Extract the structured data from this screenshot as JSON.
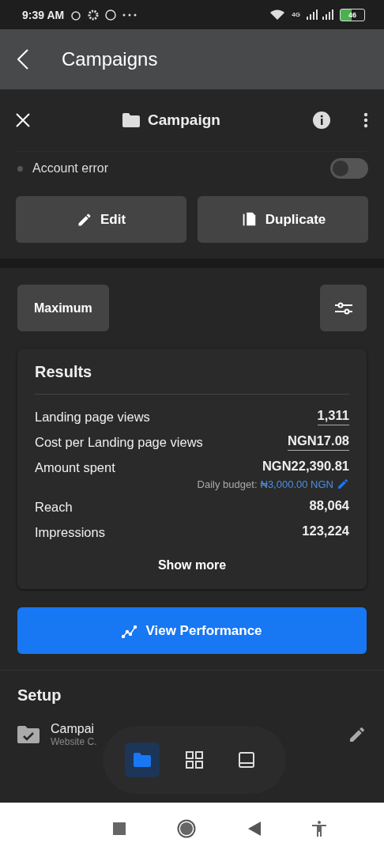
{
  "status_bar": {
    "time": "9:39 AM",
    "network": "4G",
    "battery": "46"
  },
  "app_bar": {
    "title": "Campaigns"
  },
  "header": {
    "title": "Campaign"
  },
  "status_row": {
    "label": "Account error",
    "on": false
  },
  "actions": [
    {
      "kind": "edit",
      "label": "Edit"
    },
    {
      "kind": "duplicate",
      "label": "Duplicate"
    }
  ],
  "range_button": "Maximum",
  "results": {
    "title": "Results",
    "rows": [
      {
        "label": "Landing page views",
        "value": "1,311",
        "underlined": true
      },
      {
        "label": "Cost per Landing page views",
        "value": "NGN17.08",
        "underlined": true
      },
      {
        "label": "Amount spent",
        "value": "NGN22,390.81",
        "underlined": false,
        "budget_label": "Daily budget:",
        "budget_value": "₦3,000.00 NGN"
      },
      {
        "label": "Reach",
        "value": "88,064",
        "underlined": false
      },
      {
        "label": "Impressions",
        "value": "123,224",
        "underlined": false
      }
    ],
    "more": "Show more"
  },
  "performance_button": "View Performance",
  "setup": {
    "title": "Setup",
    "item_title": "Campai",
    "item_subtitle": "Website C."
  },
  "floating_nav": [
    {
      "kind": "folder",
      "selected": true
    },
    {
      "kind": "grid",
      "selected": false
    },
    {
      "kind": "tablet",
      "selected": false
    }
  ]
}
